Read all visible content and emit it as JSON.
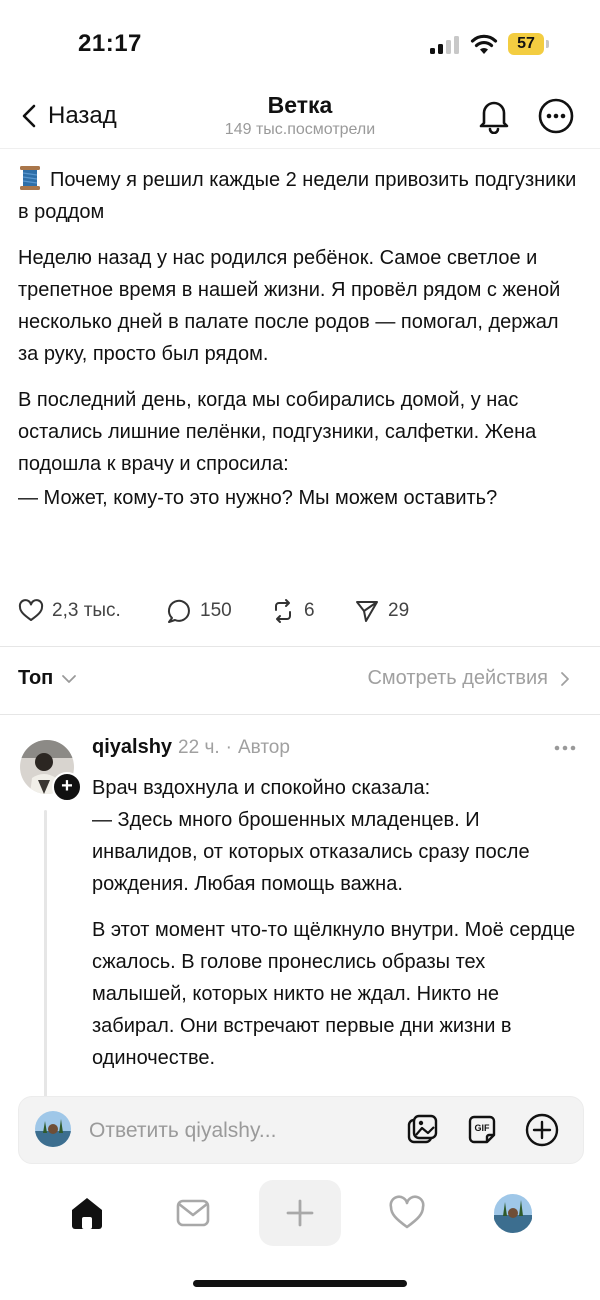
{
  "status_bar": {
    "time": "21:17",
    "battery": "57",
    "colors": {
      "battery": "#f3cd41"
    }
  },
  "header": {
    "back_label": "Назад",
    "title": "Ветка",
    "subtitle": "149 тыс.посмотрели",
    "icons": [
      "chevron-left-icon",
      "bell-icon",
      "more-icon"
    ]
  },
  "post": {
    "title_emoji": "spool-of-thread-icon",
    "title": "Почему я решил каждые 2 недели привозить подгузники в роддом",
    "paragraphs": [
      "Неделю назад у нас родился ребёнок. Самое светлое и трепетное время в нашей жизни. Я провёл рядом с женой несколько дней в палате после родов — помогал, держал за руку, просто был рядом.",
      "В последний день, когда мы собирались домой, у нас остались лишние пелёнки, подгузники, салфетки. Жена подошла к врачу и спросила:",
      "— Может, кому-то это нужно? Мы можем оставить?"
    ],
    "actions": {
      "likes": "2,3 тыс.",
      "replies": "150",
      "reposts": "6",
      "shares": "29"
    }
  },
  "sort_bar": {
    "sort_label": "Топ",
    "activity_label": "Смотреть действия"
  },
  "comment": {
    "username": "qiyalshy",
    "time": "22 ч.",
    "separator": "·",
    "role": "Автор",
    "paragraphs": [
      "Врач вздохнула и спокойно сказала:\n— Здесь много брошенных младенцев. И инвалидов, от которых отказались сразу после рождения. Любая помощь важна.",
      "В этот момент что-то щёлкнуло внутри. Моё сердце сжалось. В голове пронеслись образы тех малышей, которых никто не ждал. Никто не забирал. Они встречают первые дни жизни в одиночестве."
    ]
  },
  "reply_bar": {
    "placeholder": "Ответить qiyalshy...",
    "icons": [
      "gallery-icon",
      "gif-icon",
      "add-circle-icon"
    ]
  },
  "tab_bar": {
    "tabs": [
      "home-icon",
      "inbox-icon",
      "compose-plus-icon",
      "heart-icon",
      "profile-avatar"
    ]
  }
}
